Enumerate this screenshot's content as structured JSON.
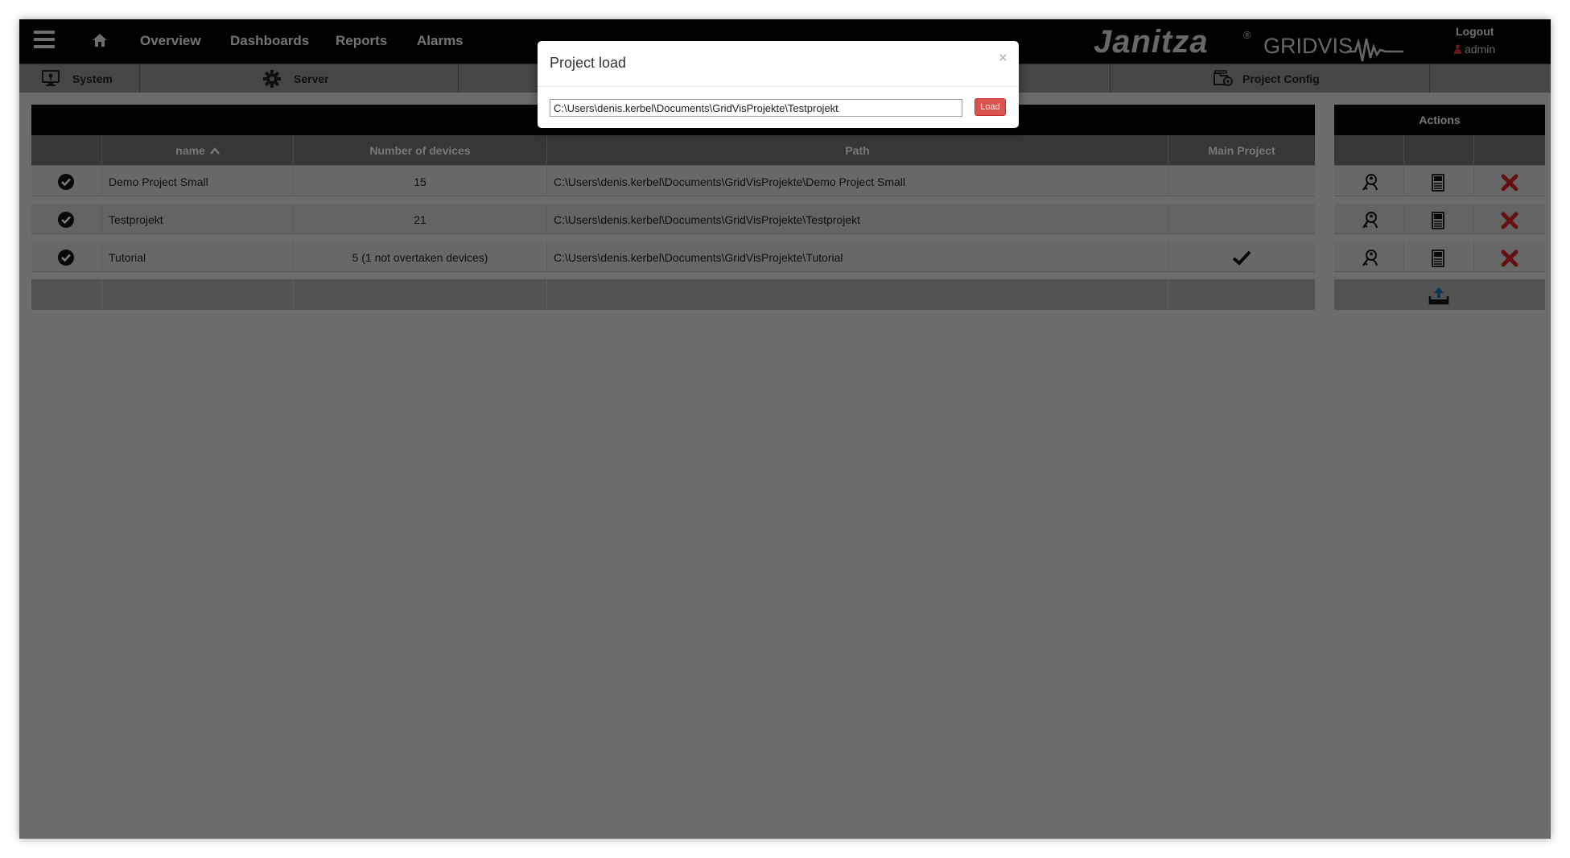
{
  "nav": {
    "items": [
      "Overview",
      "Dashboards",
      "Reports",
      "Alarms"
    ],
    "brand": "Janitza",
    "brand_mark": "®",
    "brand_product": "GRIDVIS",
    "logout": "Logout",
    "user": "admin"
  },
  "tabs": [
    {
      "label": "System",
      "icon": "monitor-icon"
    },
    {
      "label": "Server",
      "icon": "gear-icon"
    },
    {
      "label": "Project Config",
      "icon": "project-config-icon"
    }
  ],
  "table": {
    "columns": [
      "name",
      "Number of devices",
      "Path",
      "Main Project"
    ],
    "rows": [
      {
        "name": "Demo Project Small",
        "devices": "15",
        "path": "C:\\Users\\denis.kerbel\\Documents\\GridVisProjekte\\Demo Project Small",
        "main": false
      },
      {
        "name": "Testprojekt",
        "devices": "21",
        "path": "C:\\Users\\denis.kerbel\\Documents\\GridVisProjekte\\Testprojekt",
        "main": false
      },
      {
        "name": "Tutorial",
        "devices": "5 (1 not overtaken devices)",
        "path": "C:\\Users\\denis.kerbel\\Documents\\GridVisProjekte\\Tutorial",
        "main": true
      }
    ]
  },
  "actions": {
    "title": "Actions",
    "icons": [
      "key-person-icon",
      "server-icon",
      "delete-icon"
    ],
    "upload_icon": "upload-icon"
  },
  "modal": {
    "title": "Project load",
    "close": "×",
    "input_value": "C:\\Users\\denis.kerbel\\Documents\\GridVisProjekte\\Testprojekt",
    "load_label": "Load"
  },
  "colors": {
    "topbar": "#000000",
    "load_button": "#d9534f",
    "delete": "#cc1f1f"
  }
}
